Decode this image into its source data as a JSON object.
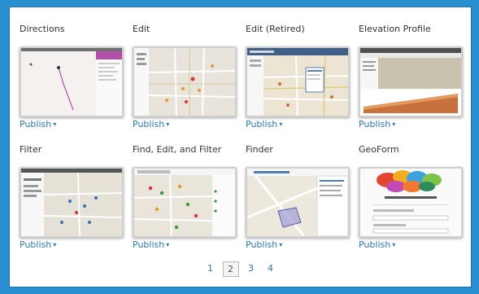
{
  "tiles": [
    {
      "title": "Directions",
      "publish": "Publish"
    },
    {
      "title": "Edit",
      "publish": "Publish"
    },
    {
      "title": "Edit (Retired)",
      "publish": "Publish"
    },
    {
      "title": "Elevation Profile",
      "publish": "Publish"
    },
    {
      "title": "Filter",
      "publish": "Publish"
    },
    {
      "title": "Find, Edit, and Filter",
      "publish": "Publish"
    },
    {
      "title": "Finder",
      "publish": "Publish"
    },
    {
      "title": "GeoForm",
      "publish": "Publish"
    }
  ],
  "caret": "▾",
  "pagination": {
    "pages": [
      "1",
      "2",
      "3",
      "4"
    ],
    "current": "2"
  },
  "colors": {
    "background": "#2a8fd0",
    "link": "#2c78b5",
    "accent_magenta": "#b44fa8",
    "accent_orange": "#c9713a"
  },
  "icons": {
    "publish_dropdown": "chevron-down-icon"
  }
}
